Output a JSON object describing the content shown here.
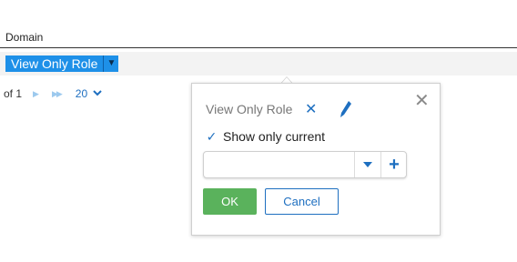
{
  "column": {
    "header": "Domain"
  },
  "filter_chip": {
    "label": "View Only Role",
    "arrow": "▼"
  },
  "pager": {
    "of_text": "of 1",
    "next_icon": "next-page-icon",
    "last_icon": "last-page-icon",
    "page_size": "20"
  },
  "popup": {
    "title": "View Only Role",
    "remove_symbol": "✕",
    "close_symbol": "✕",
    "checkbox_label": "Show only current",
    "checkbox_checked": true,
    "combo_value": "",
    "add_symbol": "+",
    "ok_label": "OK",
    "cancel_label": "Cancel"
  },
  "colors": {
    "accent": "#1e90e8",
    "link": "#1e6fc0",
    "ok_green": "#5ab25c"
  }
}
